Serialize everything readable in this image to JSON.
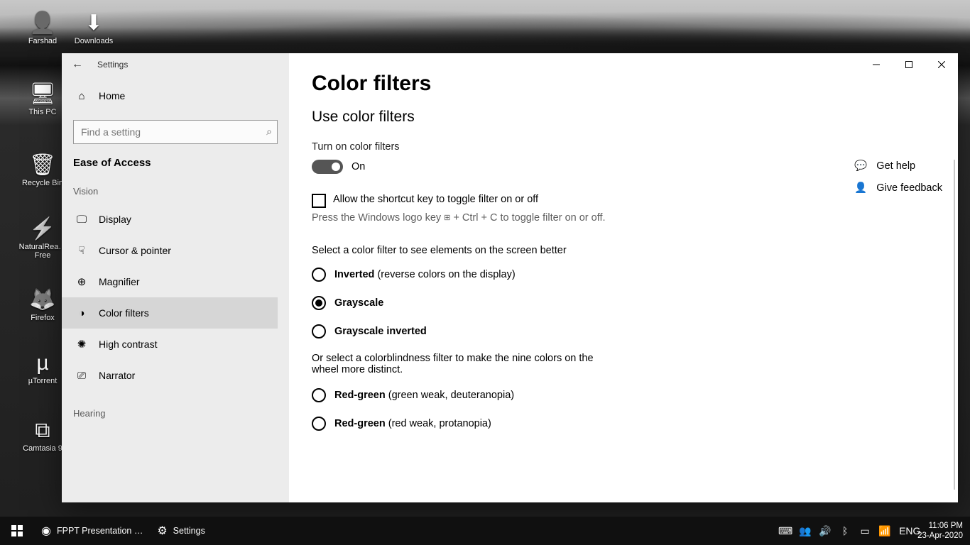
{
  "desktop_icons": [
    {
      "name": "farshad",
      "label": "Farshad",
      "glyph": "👤"
    },
    {
      "name": "downloads",
      "label": "Downloads",
      "glyph": "⬇"
    },
    {
      "name": "this-pc",
      "label": "This PC",
      "glyph": "🖥"
    },
    {
      "name": "recycle-bin",
      "label": "Recycle Bin",
      "glyph": "🗑"
    },
    {
      "name": "natural-reader",
      "label": "NaturalRea…\nFree",
      "glyph": "⚡"
    },
    {
      "name": "firefox",
      "label": "Firefox",
      "glyph": "🦊"
    },
    {
      "name": "utorrent",
      "label": "µTorrent",
      "glyph": "µ"
    },
    {
      "name": "camtasia",
      "label": "Camtasia 9",
      "glyph": "⧉"
    }
  ],
  "window": {
    "app": "Settings",
    "home": "Home",
    "search_placeholder": "Find a setting",
    "category": "Ease of Access",
    "section_vision": "Vision",
    "section_hearing": "Hearing",
    "nav": [
      {
        "id": "display",
        "label": "Display",
        "icon": "🖵"
      },
      {
        "id": "cursor",
        "label": "Cursor & pointer",
        "icon": "☟"
      },
      {
        "id": "magnifier",
        "label": "Magnifier",
        "icon": "⊕"
      },
      {
        "id": "color-filters",
        "label": "Color filters",
        "icon": "◑",
        "active": true
      },
      {
        "id": "high-contrast",
        "label": "High contrast",
        "icon": "✺"
      },
      {
        "id": "narrator",
        "label": "Narrator",
        "icon": "⎚"
      }
    ]
  },
  "page": {
    "title": "Color filters",
    "subtitle": "Use color filters",
    "toggle_label": "Turn on color filters",
    "toggle_state": "On",
    "checkbox_label": "Allow the shortcut key to toggle filter on or off",
    "hint_pre": "Press the Windows logo key ",
    "hint_post": " + Ctrl + C to toggle filter on or off.",
    "select_label": "Select a color filter to see elements on the screen better",
    "filters": [
      {
        "id": "inverted",
        "bold": "Inverted",
        "rest": " (reverse colors on the display)",
        "sel": false
      },
      {
        "id": "grayscale",
        "bold": "Grayscale",
        "rest": "",
        "sel": true
      },
      {
        "id": "grayscale-inv",
        "bold": "Grayscale inverted",
        "rest": "",
        "sel": false
      }
    ],
    "cb_note": "Or select a colorblindness filter to make the nine colors on the wheel more distinct.",
    "cb_filters": [
      {
        "id": "deuter",
        "bold": "Red-green",
        "rest": " (green weak, deuteranopia)",
        "sel": false
      },
      {
        "id": "prot",
        "bold": "Red-green",
        "rest": " (red weak, protanopia)",
        "sel": false
      }
    ],
    "help": "Get help",
    "feedback": "Give feedback"
  },
  "taskbar": {
    "tasks": [
      {
        "id": "chrome",
        "label": "FPPT Presentation …",
        "glyph": "◉"
      },
      {
        "id": "settings",
        "label": "Settings",
        "glyph": "⚙"
      }
    ],
    "lang": "ENG",
    "time": "11:06 PM",
    "date": "23-Apr-2020"
  }
}
